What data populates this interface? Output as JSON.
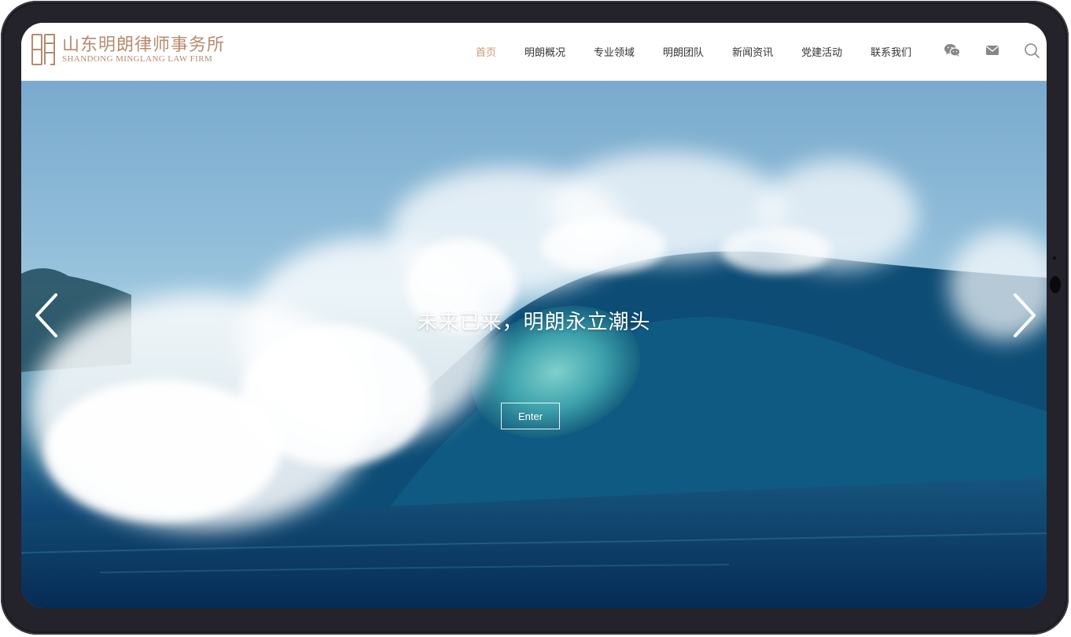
{
  "brand": {
    "name_cn": "山东明朗律师事务所",
    "name_en": "SHANDONG MINGLANG LAW FIRM",
    "color": "#b58b6e"
  },
  "nav": {
    "active_color": "#c99a72",
    "items": [
      {
        "label": "首页",
        "active": true
      },
      {
        "label": "明朗概况",
        "active": false
      },
      {
        "label": "专业领域",
        "active": false
      },
      {
        "label": "明朗团队",
        "active": false
      },
      {
        "label": "新闻资讯",
        "active": false
      },
      {
        "label": "党建活动",
        "active": false
      },
      {
        "label": "联系我们",
        "active": false
      }
    ]
  },
  "header_icons": [
    "wechat-icon",
    "mail-icon",
    "search-icon"
  ],
  "hero": {
    "slogan": "未来已来，明朗永立潮头",
    "button_label": "Enter",
    "prev_icon": "chevron-left-icon",
    "next_icon": "chevron-right-icon"
  }
}
